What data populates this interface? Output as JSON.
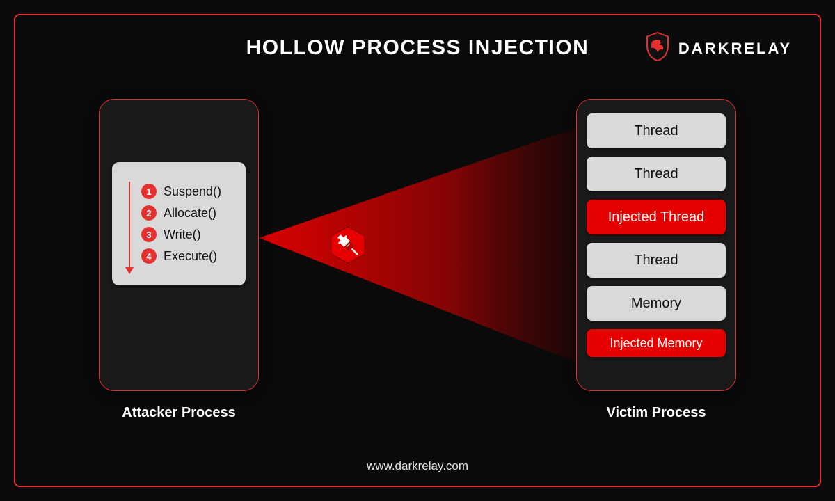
{
  "title": "HOLLOW PROCESS INJECTION",
  "brand": "DARKRELAY",
  "footer": "www.darkrelay.com",
  "attacker": {
    "caption": "Attacker Process",
    "steps": [
      {
        "n": "1",
        "label": "Suspend()"
      },
      {
        "n": "2",
        "label": "Allocate()"
      },
      {
        "n": "3",
        "label": "Write()"
      },
      {
        "n": "4",
        "label": "Execute()"
      }
    ]
  },
  "victim": {
    "caption": "Victim Process",
    "slots": [
      {
        "label": "Thread",
        "injected": false
      },
      {
        "label": "Thread",
        "injected": false
      },
      {
        "label": "Injected Thread",
        "injected": true
      },
      {
        "label": "Thread",
        "injected": false
      },
      {
        "label": "Memory",
        "injected": false
      },
      {
        "label": "Injected Memory",
        "injected": true,
        "small": true
      }
    ]
  },
  "colors": {
    "accent": "#e63030",
    "bg": "#0a0a0a",
    "card": "#1a1a1a",
    "slot": "#d9d9d9",
    "inject": "#e60000"
  }
}
